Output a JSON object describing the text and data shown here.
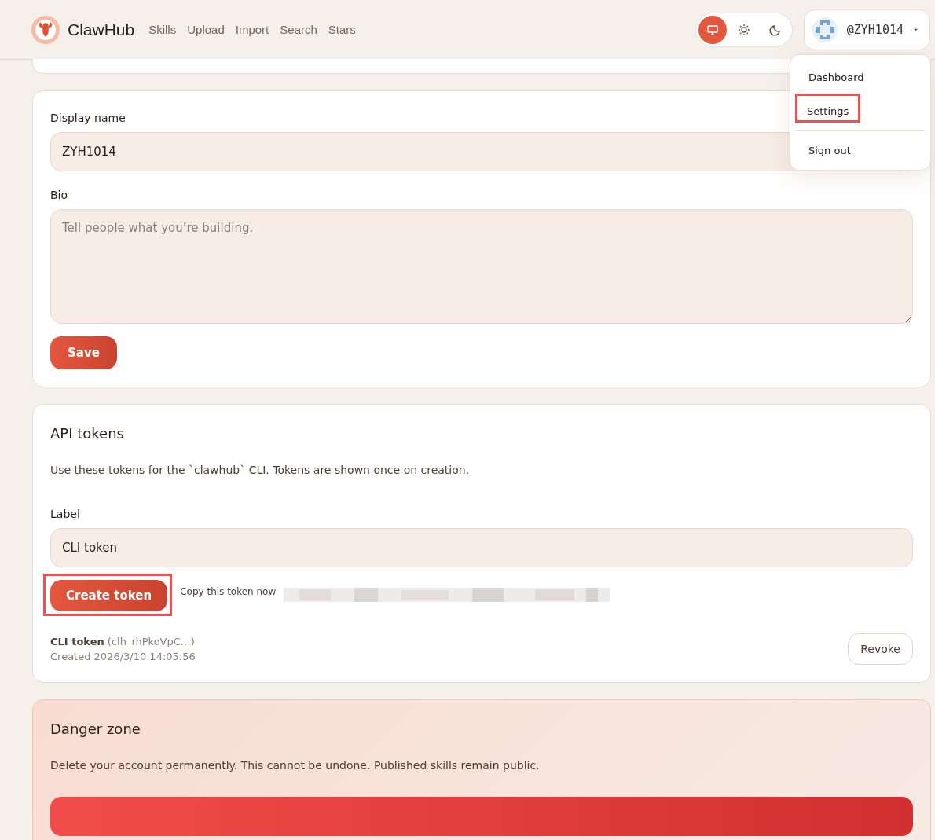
{
  "header": {
    "brand": "ClawHub",
    "nav": [
      {
        "label": "Skills"
      },
      {
        "label": "Upload"
      },
      {
        "label": "Import"
      },
      {
        "label": "Search"
      },
      {
        "label": "Stars"
      }
    ],
    "theme_options": [
      {
        "kind": "system",
        "selected": true
      },
      {
        "kind": "light",
        "selected": false
      },
      {
        "kind": "dark",
        "selected": false
      }
    ],
    "user": {
      "handle": "@ZYH1014"
    }
  },
  "user_menu": {
    "items": [
      {
        "label": "Dashboard",
        "highlighted": false,
        "divider_after": false
      },
      {
        "label": "Settings",
        "highlighted": true,
        "divider_after": true
      },
      {
        "label": "Sign out",
        "highlighted": false,
        "divider_after": false
      }
    ]
  },
  "profile": {
    "display_name_label": "Display name",
    "display_name": "ZYH1014",
    "bio_label": "Bio",
    "bio_placeholder": "Tell people what you’re building.",
    "save": "Save"
  },
  "api_tokens": {
    "title": "API tokens",
    "description": "Use these tokens for the `clawhub` CLI. Tokens are shown once on creation.",
    "label_label": "Label",
    "label_value": "CLI token",
    "create": {
      "label": "Create token",
      "highlighted": true
    },
    "copy_note": "Copy this token now",
    "tokens": [
      {
        "name": "CLI token",
        "prefix": "(clh_rhPkoVpC…)",
        "created": "Created 2026/3/10 14:05:56",
        "revoke": "Revoke"
      }
    ]
  },
  "danger_zone": {
    "title": "Danger zone",
    "description": "Delete your account permanently. This cannot be undone. Published skills remain public."
  }
}
